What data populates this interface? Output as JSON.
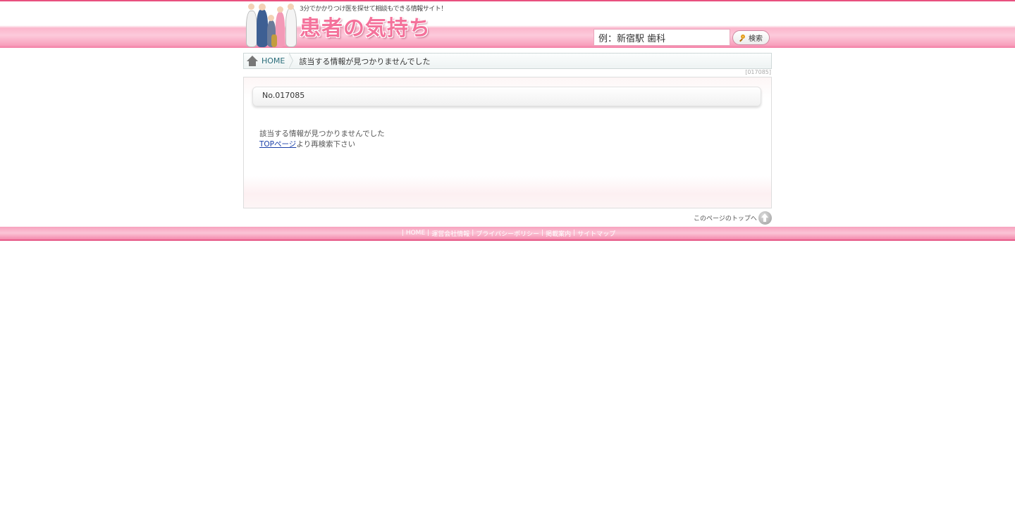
{
  "header": {
    "tagline": "3分でかかりつけ医を探せて相談もできる情報サイト！",
    "site_title": "患者の気持ち",
    "search": {
      "value": "例：新宿駅 歯科",
      "button_label": "検索"
    }
  },
  "breadcrumb": {
    "home": "HOME",
    "current": "該当する情報が見つかりませんでした"
  },
  "page_code": "[017085]",
  "content": {
    "title": "No.017085",
    "message": "該当する情報が見つかりませんでした",
    "top_link": "TOPページ",
    "suffix": "より再検索下さい"
  },
  "to_top": "このページのトップへ",
  "footer": {
    "sep": "|",
    "links": [
      "HOME",
      "運営会社情報",
      "プライバシーポリシー",
      "掲載案内",
      "サイトマップ"
    ]
  },
  "colors": {
    "accent": "#f4729b",
    "border": "#e8507f",
    "link": "#1a3fa8"
  }
}
